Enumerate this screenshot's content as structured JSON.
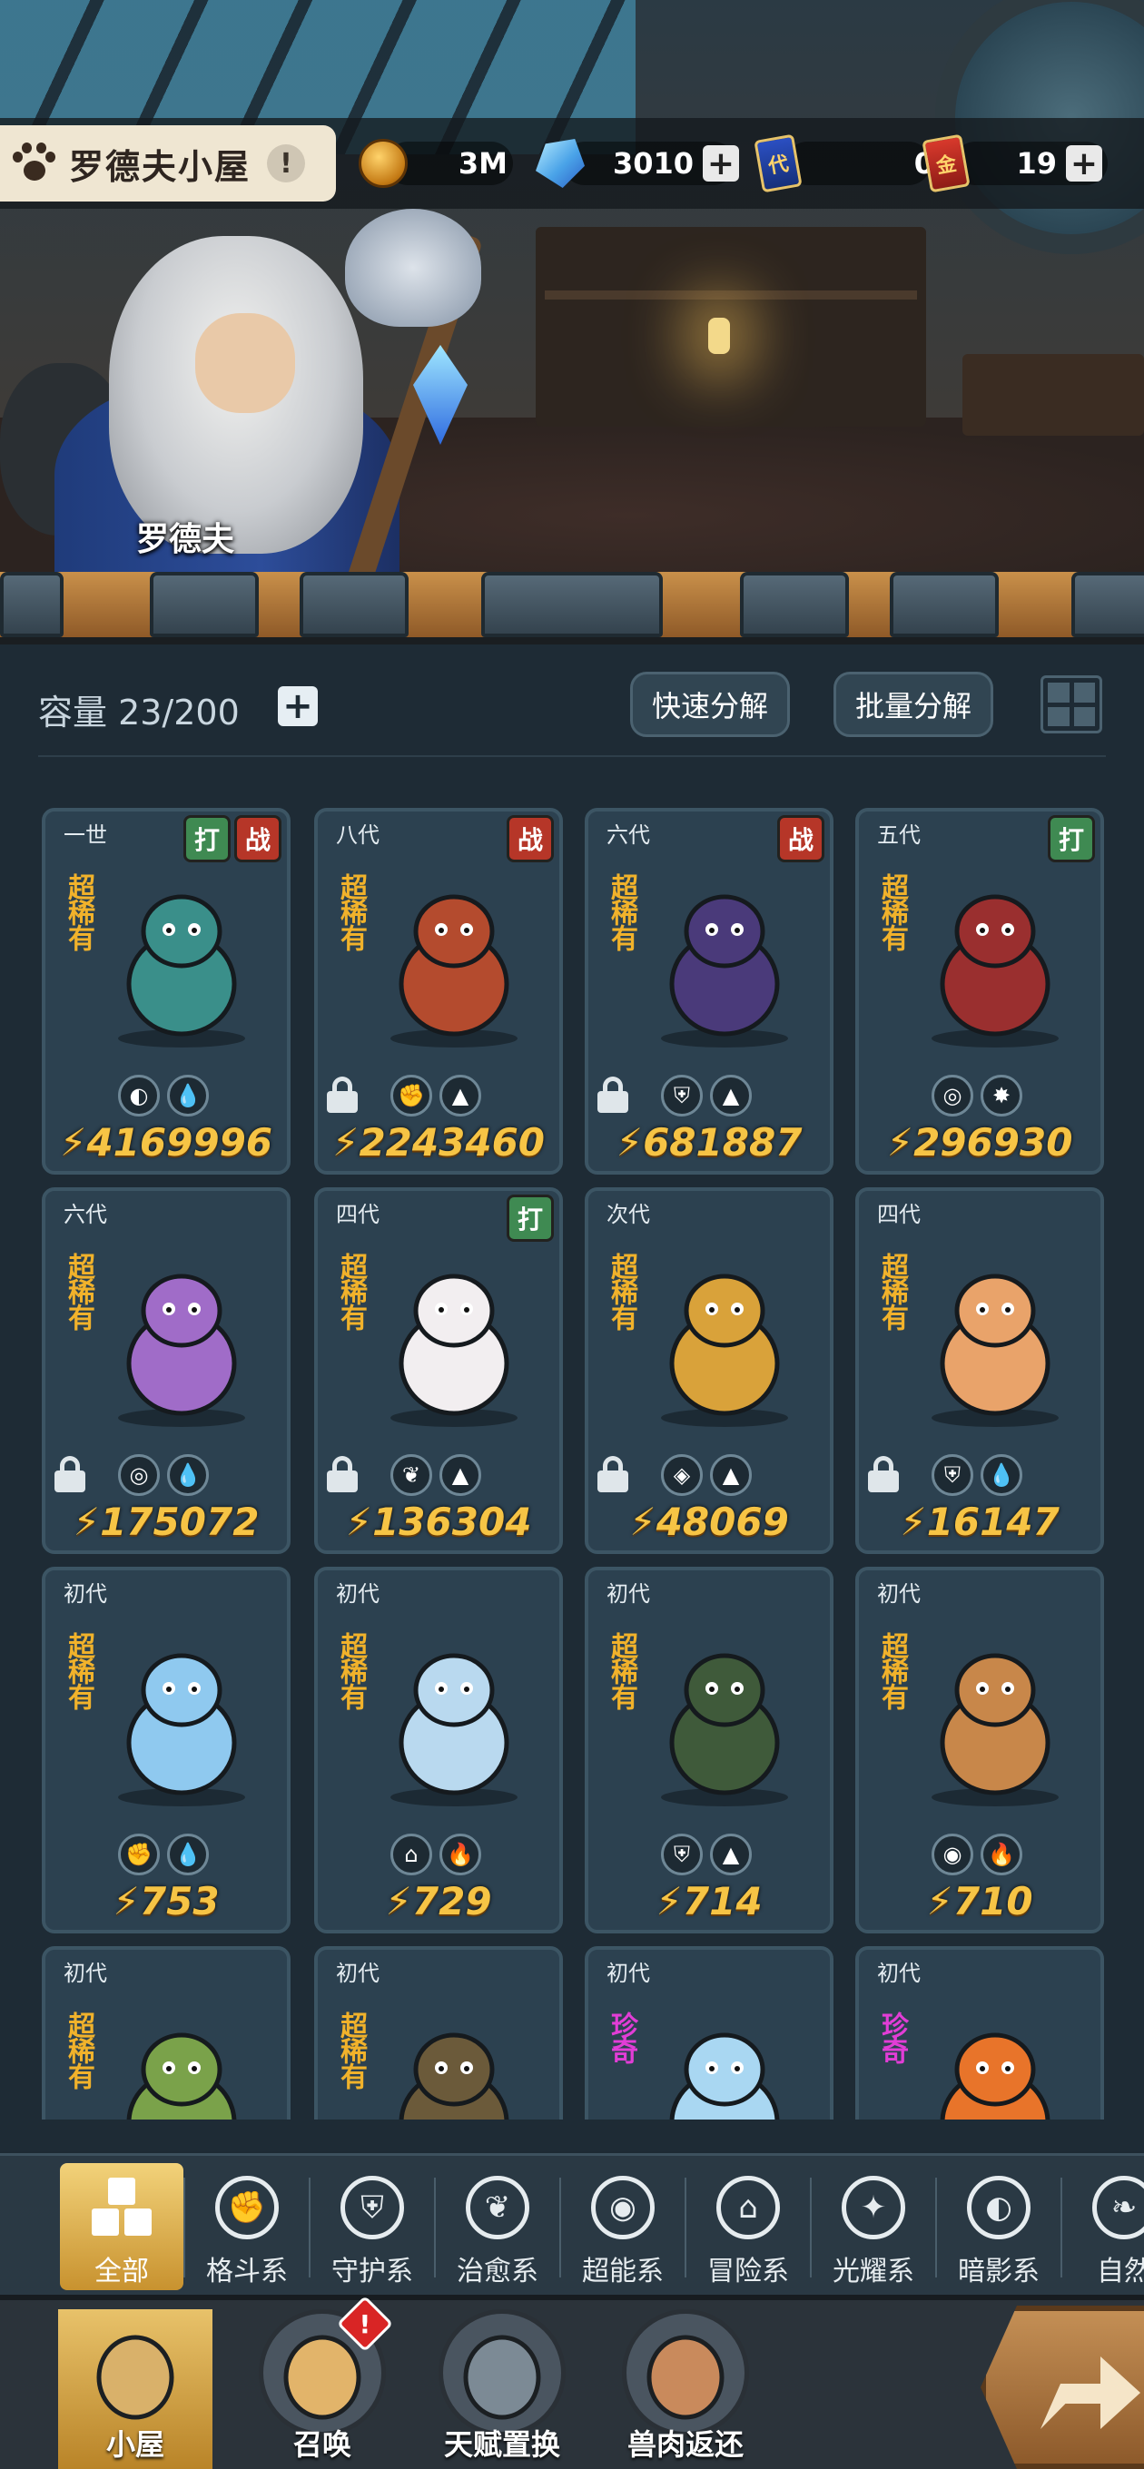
{
  "house": {
    "title": "罗德夫小屋",
    "info": "!"
  },
  "npc": {
    "name": "罗德夫"
  },
  "resources": [
    {
      "icon": "gold-coin-icon",
      "value": "3M",
      "has_plus": false
    },
    {
      "icon": "crystal-gem-icon",
      "value": "3010",
      "has_plus": true
    },
    {
      "icon": "generation-card-icon",
      "badge": "代",
      "value": "0",
      "has_plus": false
    },
    {
      "icon": "gold-card-icon",
      "badge": "金",
      "value": "19",
      "has_plus": true
    }
  ],
  "capacity": {
    "label": "容量 23/200"
  },
  "buttons": {
    "quick_decompose": "快速分解",
    "batch_decompose": "批量分解"
  },
  "cards": [
    {
      "gen": "一世",
      "rarity": "超稀有",
      "tags": [
        "打",
        "战"
      ],
      "locked": false,
      "elements": [
        "◐",
        "💧"
      ],
      "power": "4169996",
      "color": "#3a8f8a"
    },
    {
      "gen": "八代",
      "rarity": "超稀有",
      "tags": [
        "战"
      ],
      "locked": true,
      "elements": [
        "✊",
        "▲"
      ],
      "power": "2243460",
      "color": "#b44b2e"
    },
    {
      "gen": "六代",
      "rarity": "超稀有",
      "tags": [
        "战"
      ],
      "locked": true,
      "elements": [
        "⛨",
        "▲"
      ],
      "power": "681887",
      "color": "#4a3a7a"
    },
    {
      "gen": "五代",
      "rarity": "超稀有",
      "tags": [
        "打"
      ],
      "locked": false,
      "elements": [
        "◎",
        "✸"
      ],
      "power": "296930",
      "color": "#9a2f2f"
    },
    {
      "gen": "六代",
      "rarity": "超稀有",
      "tags": [],
      "locked": true,
      "elements": [
        "◎",
        "💧"
      ],
      "power": "175072",
      "color": "#a06cc8"
    },
    {
      "gen": "四代",
      "rarity": "超稀有",
      "tags": [
        "打"
      ],
      "locked": true,
      "elements": [
        "❦",
        "▲"
      ],
      "power": "136304",
      "color": "#f2eef0"
    },
    {
      "gen": "次代",
      "rarity": "超稀有",
      "tags": [],
      "locked": true,
      "elements": [
        "◈",
        "▲"
      ],
      "power": "48069",
      "color": "#d9a23a"
    },
    {
      "gen": "四代",
      "rarity": "超稀有",
      "tags": [],
      "locked": true,
      "elements": [
        "⛨",
        "💧"
      ],
      "power": "16147",
      "color": "#e9a36a"
    },
    {
      "gen": "初代",
      "rarity": "超稀有",
      "tags": [],
      "locked": false,
      "elements": [
        "✊",
        "💧"
      ],
      "power": "753",
      "color": "#8fc9ef"
    },
    {
      "gen": "初代",
      "rarity": "超稀有",
      "tags": [],
      "locked": false,
      "elements": [
        "⌂",
        "🔥"
      ],
      "power": "729",
      "color": "#b9d9ef"
    },
    {
      "gen": "初代",
      "rarity": "超稀有",
      "tags": [],
      "locked": false,
      "elements": [
        "⛨",
        "▲"
      ],
      "power": "714",
      "color": "#3f5a3a"
    },
    {
      "gen": "初代",
      "rarity": "超稀有",
      "tags": [],
      "locked": false,
      "elements": [
        "◉",
        "🔥"
      ],
      "power": "710",
      "color": "#c8874a"
    },
    {
      "gen": "初代",
      "rarity": "超稀有",
      "tags": [],
      "locked": false,
      "elements": [],
      "power": "",
      "color": "#7aa24a"
    },
    {
      "gen": "初代",
      "rarity": "超稀有",
      "tags": [],
      "locked": false,
      "elements": [],
      "power": "",
      "color": "#6b5a3a"
    },
    {
      "gen": "初代",
      "rarity": "珍奇",
      "tags": [],
      "locked": false,
      "elements": [],
      "power": "",
      "color": "#a9d7f2"
    },
    {
      "gen": "初代",
      "rarity": "珍奇",
      "tags": [],
      "locked": false,
      "elements": [],
      "power": "",
      "color": "#e8742a"
    }
  ],
  "categories": [
    {
      "label": "全部",
      "icon": "all-grid-icon",
      "glyph": ""
    },
    {
      "label": "格斗系",
      "icon": "fist-icon",
      "glyph": "✊"
    },
    {
      "label": "守护系",
      "icon": "shield-icon",
      "glyph": "⛨"
    },
    {
      "label": "治愈系",
      "icon": "sprout-icon",
      "glyph": "❦"
    },
    {
      "label": "超能系",
      "icon": "alien-icon",
      "glyph": "◉"
    },
    {
      "label": "冒险系",
      "icon": "lantern-icon",
      "glyph": "⌂"
    },
    {
      "label": "光耀系",
      "icon": "star-burst-icon",
      "glyph": "✦"
    },
    {
      "label": "暗影系",
      "icon": "shadow-eye-icon",
      "glyph": "◐"
    },
    {
      "label": "自然",
      "icon": "leaf-icon",
      "glyph": "❧"
    }
  ],
  "nav": [
    {
      "label": "小屋",
      "icon": "house-icon"
    },
    {
      "label": "召唤",
      "icon": "egg-icon"
    },
    {
      "label": "天赋置换",
      "icon": "swap-arrows-icon"
    },
    {
      "label": "兽肉返还",
      "icon": "meat-icon"
    }
  ],
  "summon_badge": "!"
}
